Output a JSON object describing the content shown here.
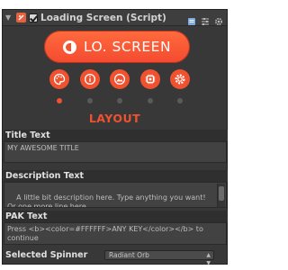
{
  "header": {
    "title": "Loading Screen (Script)",
    "icons": [
      "component-script-icon",
      "help-book-icon",
      "preset-sliders-icon",
      "settings-gear-icon"
    ],
    "enabled": true
  },
  "active_tab": {
    "label": "LO. SCREEN",
    "icon": "loading-screen-icon"
  },
  "tab_icons": [
    "palette-icon",
    "info-icon",
    "image-icon",
    "chip-icon",
    "gear-icon"
  ],
  "tab_dots": [
    false,
    false,
    false,
    false,
    false
  ],
  "section": {
    "title": "LAYOUT"
  },
  "title_text": {
    "label": "Title Text",
    "value": "MY AWESOME TITLE"
  },
  "description_text": {
    "label": "Description Text",
    "value": "A little bit description here. Type anything you want!\nOr one more line here..."
  },
  "pak_text": {
    "label": "PAK Text",
    "value": "Press <b><color=#FFFFFF>ANY KEY</color></b> to continue"
  },
  "selected_spinner": {
    "label": "Selected Spinner",
    "value": "Radiant Orb"
  },
  "colors": {
    "accent": "#f0512f",
    "panel_bg": "#383838",
    "field_bg": "#424242"
  }
}
